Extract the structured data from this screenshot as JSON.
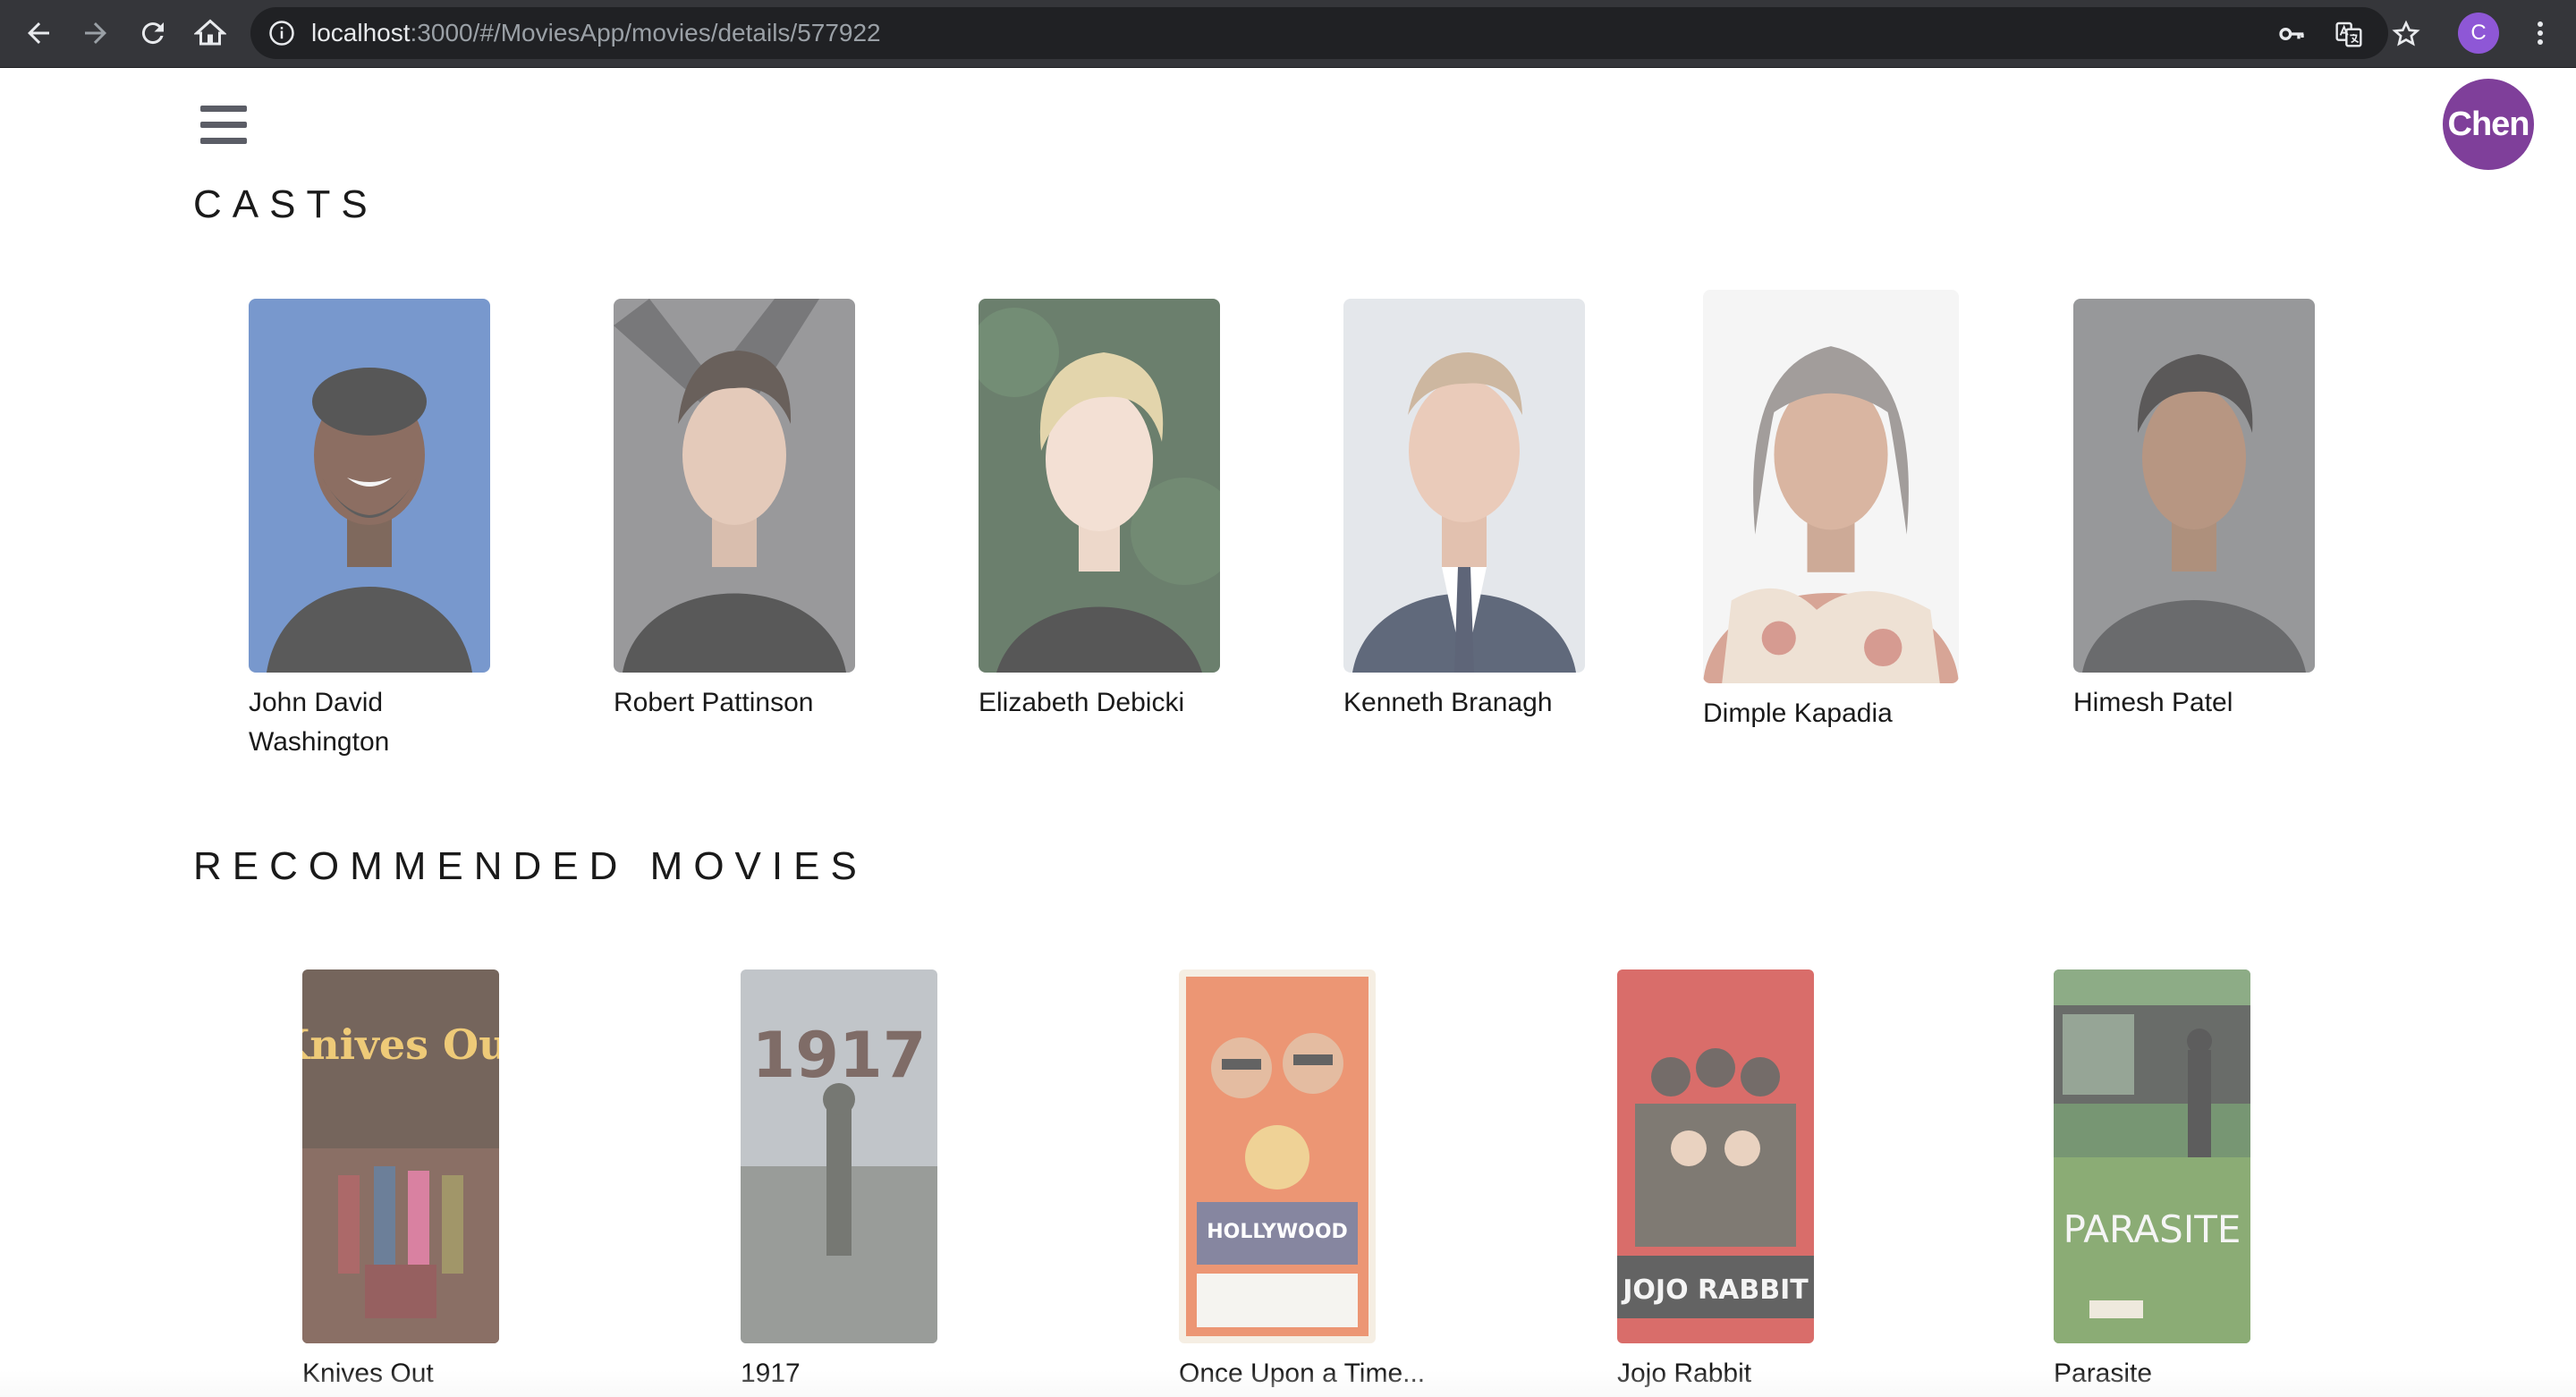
{
  "browser": {
    "url_host": "localhost",
    "url_path": ":3000/#/MoviesApp/movies/details/577922",
    "profile_initial": "C"
  },
  "header": {
    "user_label": "Chen"
  },
  "casts": {
    "title": "CASTS",
    "items": [
      {
        "name": "John David Washington"
      },
      {
        "name": "Robert Pattinson"
      },
      {
        "name": "Elizabeth Debicki"
      },
      {
        "name": "Kenneth Branagh"
      },
      {
        "name": "Dimple Kapadia"
      },
      {
        "name": "Himesh Patel"
      }
    ]
  },
  "recommended": {
    "title": "RECOMMENDED MOVIES",
    "items": [
      {
        "title": "Knives Out",
        "poster_text": "Knives Out"
      },
      {
        "title": "1917",
        "poster_text": "1917"
      },
      {
        "title": "Once Upon a Time...",
        "poster_text": "HOLLYWOOD"
      },
      {
        "title": "Jojo Rabbit",
        "poster_text": "JOJO RABBIT"
      },
      {
        "title": "Parasite",
        "poster_text": "PARASITE"
      }
    ]
  },
  "colors": {
    "chrome_bg": "#35363a",
    "omnibox_bg": "#202124",
    "avatar_bg": "#7f3f9a",
    "profile_chip_bg": "#8e57d6"
  }
}
